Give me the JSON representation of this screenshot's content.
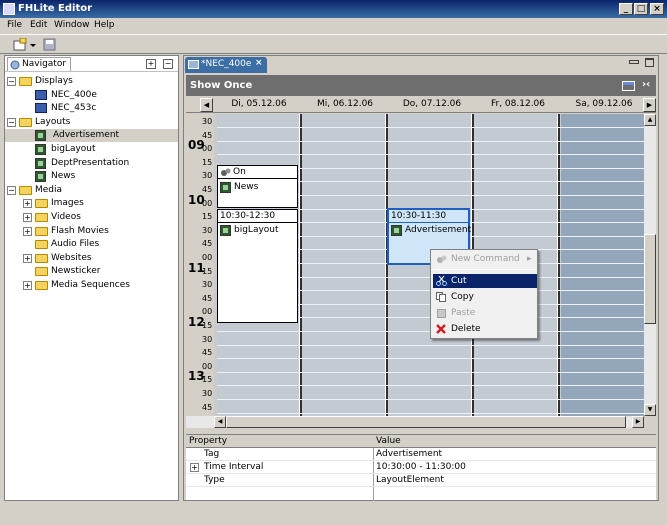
{
  "window": {
    "title": "FHLite Editor"
  },
  "menu": [
    "File",
    "Edit",
    "Window",
    "Help"
  ],
  "navigator": {
    "tab_label": "Navigator",
    "tree": [
      {
        "label": "Displays",
        "icon": "folder-icon",
        "expanded": true,
        "level": 0
      },
      {
        "label": "NEC_400e",
        "icon": "monitor-icon",
        "level": 1
      },
      {
        "label": "NEC_453c",
        "icon": "monitor-icon",
        "level": 1
      },
      {
        "label": "Layouts",
        "icon": "folder-icon",
        "expanded": true,
        "level": 0
      },
      {
        "label": "Advertisement",
        "icon": "layout-icon",
        "level": 1,
        "selected": true
      },
      {
        "label": "bigLayout",
        "icon": "layout-icon",
        "level": 1
      },
      {
        "label": "DeptPresentation",
        "icon": "layout-icon",
        "level": 1
      },
      {
        "label": "News",
        "icon": "layout-icon",
        "level": 1
      },
      {
        "label": "Media",
        "icon": "folder-icon",
        "expanded": true,
        "level": 0
      },
      {
        "label": "Images",
        "icon": "folder-icon",
        "level": 1,
        "expandable": true
      },
      {
        "label": "Videos",
        "icon": "folder-icon",
        "level": 1,
        "expandable": true
      },
      {
        "label": "Flash Movies",
        "icon": "folder-icon",
        "level": 1,
        "expandable": true
      },
      {
        "label": "Audio Files",
        "icon": "folder-icon",
        "level": 1
      },
      {
        "label": "Websites",
        "icon": "folder-icon",
        "level": 1,
        "expandable": true
      },
      {
        "label": "Newsticker",
        "icon": "folder-icon",
        "level": 1
      },
      {
        "label": "Media Sequences",
        "icon": "folder-icon",
        "level": 1,
        "expandable": true
      }
    ]
  },
  "editor": {
    "tab_label": "*NEC_400e",
    "view_title": "Show Once",
    "days": [
      "Di, 05.12.06",
      "Mi, 06.12.06",
      "Do, 07.12.06",
      "Fr, 08.12.06",
      "Sa, 09.12.06"
    ],
    "time_rows": [
      {
        "hour": "",
        "min": "30"
      },
      {
        "hour": "",
        "min": "45"
      },
      {
        "hour": "09",
        "min": "00"
      },
      {
        "hour": "",
        "min": "15"
      },
      {
        "hour": "",
        "min": "30"
      },
      {
        "hour": "",
        "min": "45"
      },
      {
        "hour": "10",
        "min": "00"
      },
      {
        "hour": "",
        "min": "15"
      },
      {
        "hour": "",
        "min": "30"
      },
      {
        "hour": "",
        "min": "45"
      },
      {
        "hour": "",
        "min": "00"
      },
      {
        "hour": "11",
        "min": "15"
      },
      {
        "hour": "",
        "min": "30"
      },
      {
        "hour": "",
        "min": "45"
      },
      {
        "hour": "",
        "min": "00"
      },
      {
        "hour": "12",
        "min": "15"
      },
      {
        "hour": "",
        "min": "30"
      },
      {
        "hour": "",
        "min": "45"
      },
      {
        "hour": "",
        "min": "00"
      },
      {
        "hour": "13",
        "min": "15"
      },
      {
        "hour": "",
        "min": "30"
      },
      {
        "hour": "",
        "min": "45"
      }
    ],
    "events": {
      "on_news": {
        "header": "On",
        "item": "News"
      },
      "biglayout": {
        "header": "10:30-12:30",
        "item": "bigLayout"
      },
      "advertisement": {
        "header": "10:30-11:30",
        "item": "Advertisement"
      }
    }
  },
  "context_menu": {
    "items": [
      {
        "label": "New Command",
        "icon": "command-icon",
        "disabled": true,
        "submenu": true
      },
      {
        "label": "Cut",
        "icon": "scissors-icon",
        "selected": true
      },
      {
        "label": "Copy",
        "icon": "copy-icon"
      },
      {
        "label": "Paste",
        "icon": "paste-icon",
        "disabled": true
      },
      {
        "label": "Delete",
        "icon": "delete-icon"
      }
    ]
  },
  "properties": {
    "headers": [
      "Property",
      "Value"
    ],
    "rows": [
      {
        "property": "Tag",
        "value": "Advertisement"
      },
      {
        "property": "Time Interval",
        "value": "10:30:00 - 11:30:00",
        "expandable": true
      },
      {
        "property": "Type",
        "value": "LayoutElement"
      }
    ]
  }
}
